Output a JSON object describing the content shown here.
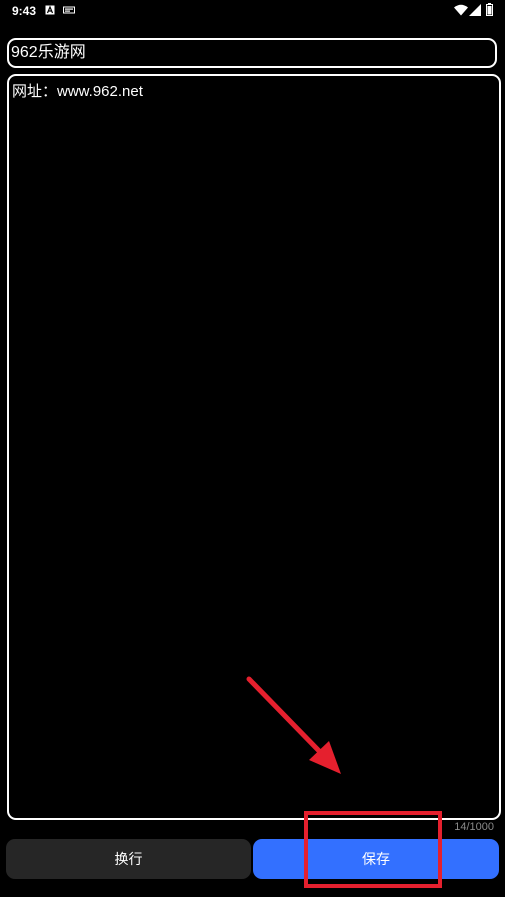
{
  "status_bar": {
    "time": "9:43",
    "icons": [
      "accessibility-a-icon",
      "notification-icon",
      "wifi-icon",
      "signal-icon",
      "battery-icon"
    ]
  },
  "editor": {
    "title_value": "962乐游网",
    "content_value": "网址：www.962.net",
    "char_count": "14/1000"
  },
  "buttons": {
    "newline_label": "换行",
    "save_label": "保存"
  },
  "annotation": {
    "highlight_color": "#e5202e",
    "arrow_color": "#e5202e"
  },
  "colors": {
    "background": "#000000",
    "field_border": "#ffffff",
    "save_button": "#3370ff",
    "newline_button": "#262626",
    "counter_text": "#8a8a8a"
  }
}
